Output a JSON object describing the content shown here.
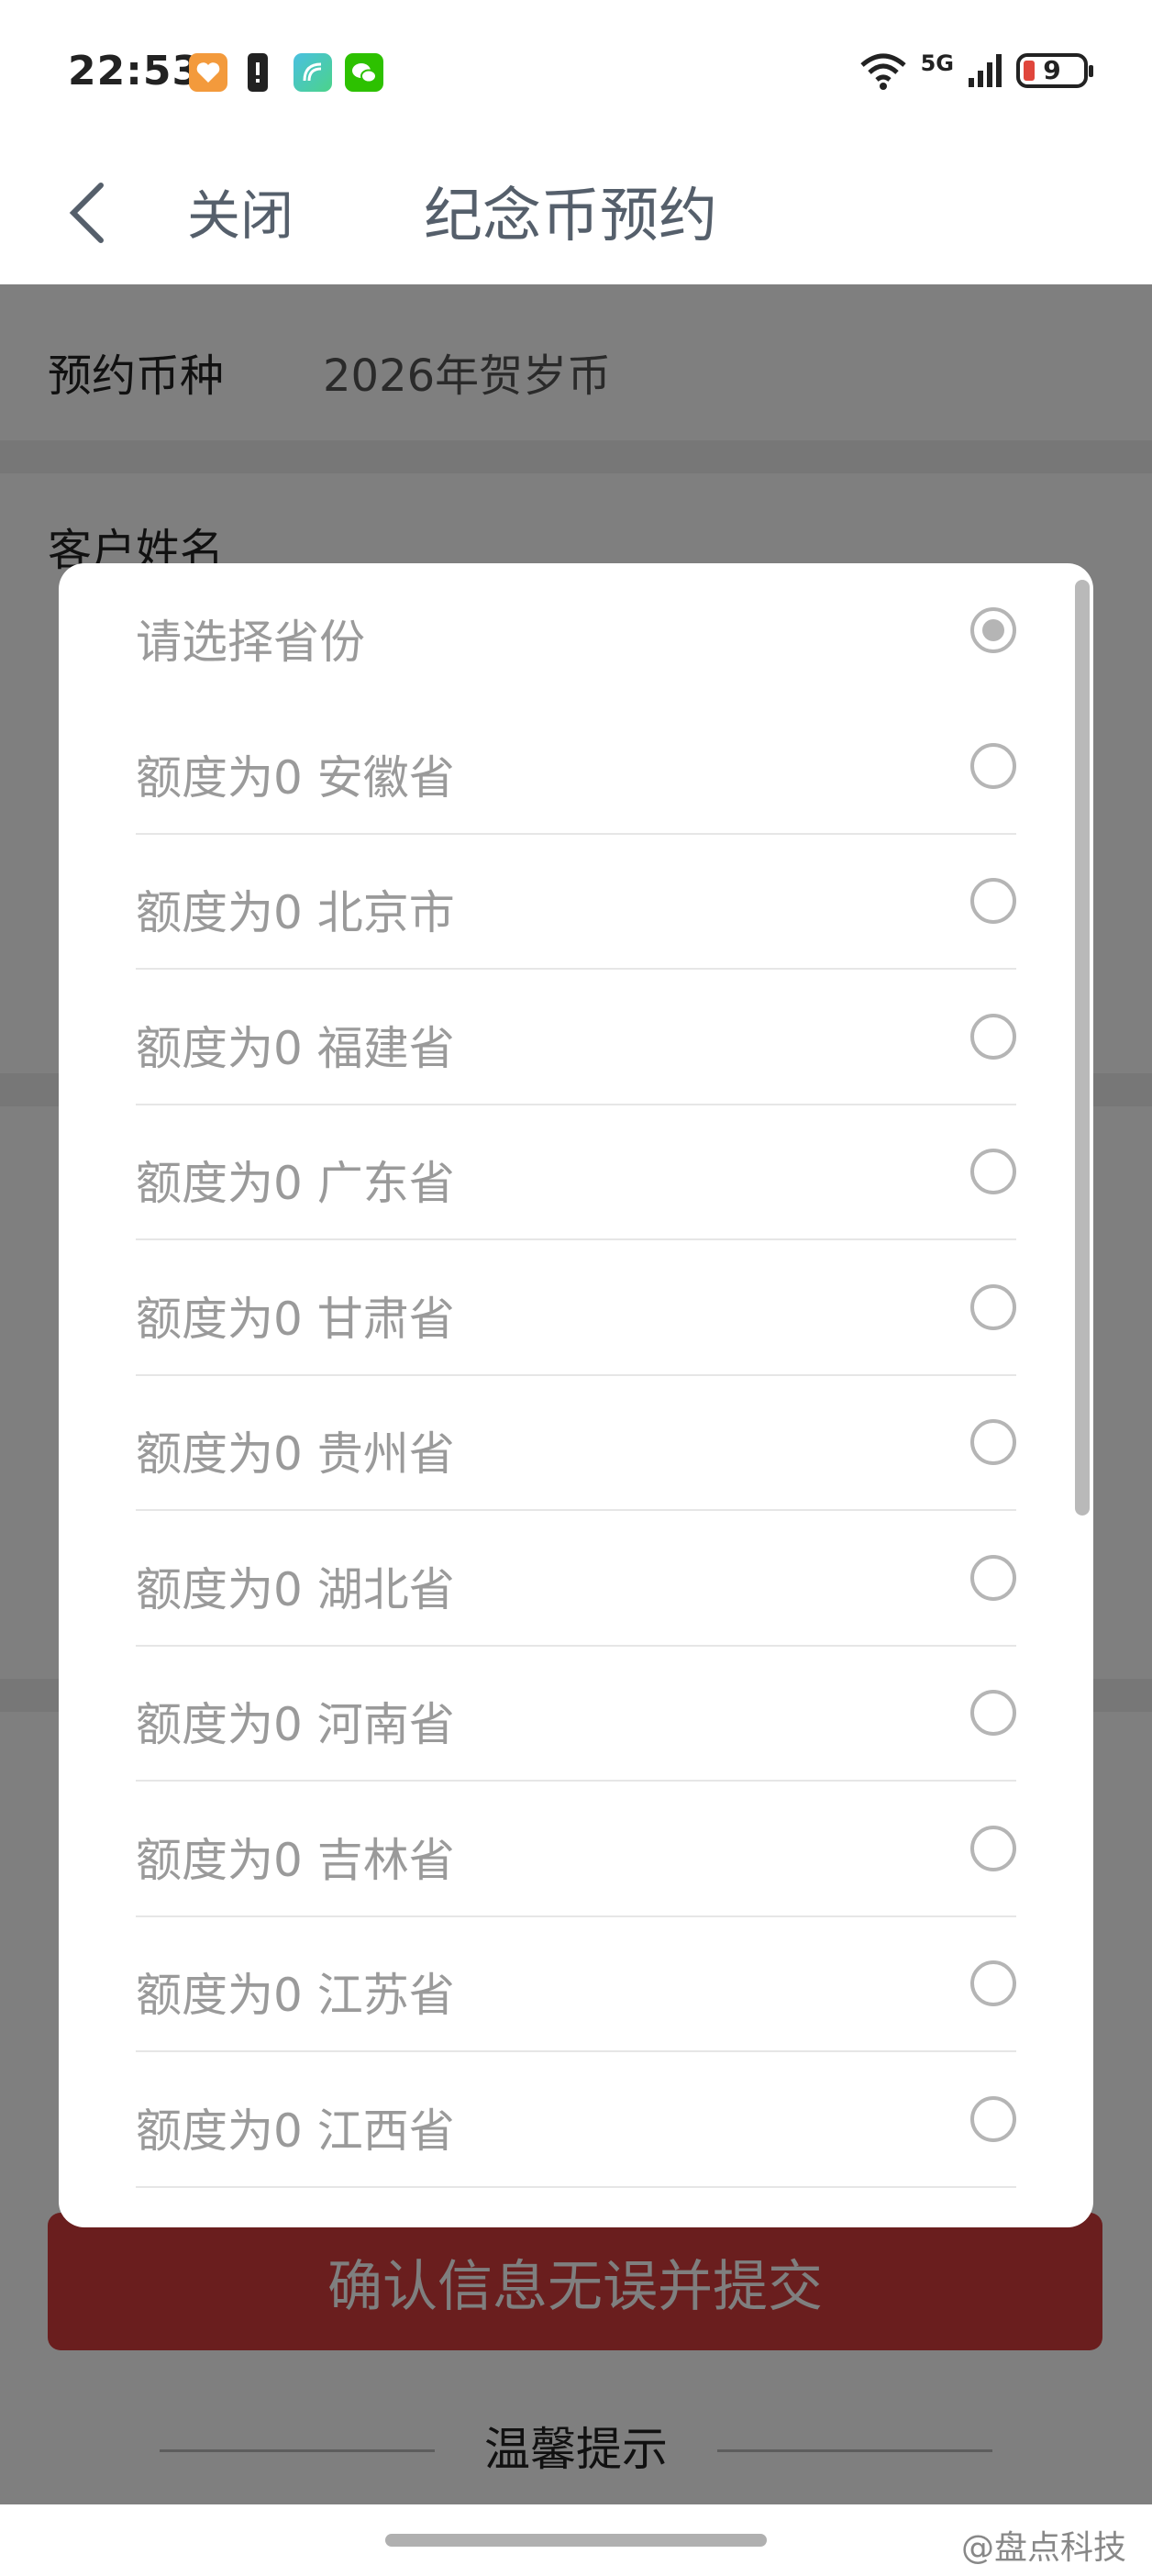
{
  "status_bar": {
    "time": "22:53",
    "network": "5G",
    "battery": "9",
    "icons": [
      "health-app-icon",
      "battery-alert-icon",
      "nfc-app-icon",
      "wechat-icon",
      "wifi-icon",
      "signal-icon"
    ]
  },
  "nav": {
    "close_label": "关闭",
    "title": "纪念币预约"
  },
  "form": {
    "coin_label": "预约币种",
    "coin_value": "2026年贺岁币",
    "name_label": "客户姓名"
  },
  "modal": {
    "options": [
      {
        "text": "请选择省份",
        "checked": true
      },
      {
        "text": "额度为0 安徽省",
        "checked": false
      },
      {
        "text": "额度为0 北京市",
        "checked": false
      },
      {
        "text": "额度为0 福建省",
        "checked": false
      },
      {
        "text": "额度为0 广东省",
        "checked": false
      },
      {
        "text": "额度为0 甘肃省",
        "checked": false
      },
      {
        "text": "额度为0 贵州省",
        "checked": false
      },
      {
        "text": "额度为0 湖北省",
        "checked": false
      },
      {
        "text": "额度为0 河南省",
        "checked": false
      },
      {
        "text": "额度为0 吉林省",
        "checked": false
      },
      {
        "text": "额度为0 江苏省",
        "checked": false
      },
      {
        "text": "额度为0 江西省",
        "checked": false
      }
    ]
  },
  "submit_label": "确认信息无误并提交",
  "tips_label": "温馨提示",
  "watermark": "@盘点科技",
  "colors": {
    "submit": "#d53c3d",
    "overlay": "rgba(0,0,0,0.5)",
    "option_text": "#9a9a9a"
  }
}
